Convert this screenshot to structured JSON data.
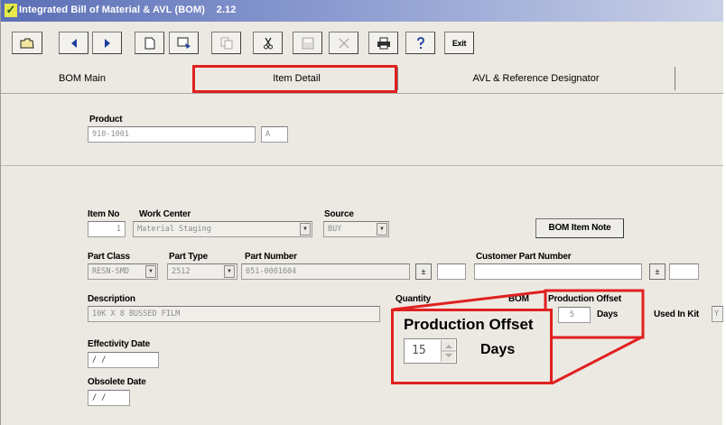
{
  "window": {
    "title": "Integrated Bill of Material & AVL (BOM)    2.12"
  },
  "toolbar": {
    "buttons": [
      {
        "icon": "folder-open-icon"
      },
      {
        "icon": "previous-icon"
      },
      {
        "icon": "next-icon"
      },
      {
        "icon": "new-document-icon"
      },
      {
        "icon": "find-icon"
      },
      {
        "icon": "copy-icon"
      },
      {
        "icon": "cut-icon"
      },
      {
        "icon": "save-icon"
      },
      {
        "icon": "delete-icon"
      },
      {
        "icon": "print-icon"
      },
      {
        "icon": "help-icon"
      },
      {
        "label": "Exit"
      }
    ]
  },
  "tabs": [
    {
      "label": "BOM Main"
    },
    {
      "label": "Item Detail"
    },
    {
      "label": "AVL & Reference Designator"
    }
  ],
  "product": {
    "label": "Product",
    "value": "910-1001",
    "rev": "A"
  },
  "item": {
    "item_no_label": "Item No",
    "item_no": "1",
    "work_center_label": "Work Center",
    "work_center": "Material Staging",
    "source_label": "Source",
    "source": "BUY",
    "note_button": "BOM Item Note",
    "part_class_label": "Part Class",
    "part_class": "RESN-SMD",
    "part_type_label": "Part Type",
    "part_type": "2512",
    "part_number_label": "Part Number",
    "part_number": "051-0001604",
    "customer_part_label": "Customer Part Number",
    "customer_part": "",
    "description_label": "Description",
    "description": "10K X 8 BUSSED FILM",
    "quantity_label": "Quantity",
    "bom_label": "BOM",
    "production_offset_label": "Production Offset",
    "production_offset": "5",
    "days_label": "Days",
    "used_in_kit_label": "Used In Kit",
    "used_in_kit": "Y",
    "effectivity_label": "Effectivity Date",
    "effectivity_value": "/  /",
    "obsolete_label": "Obsolete Date",
    "obsolete_value": "/  /"
  },
  "zoom": {
    "title": "Production Offset",
    "value": "15",
    "days": "Days"
  },
  "colors": {
    "highlight": "#e02020",
    "title_bar": "#5b6fb5"
  }
}
